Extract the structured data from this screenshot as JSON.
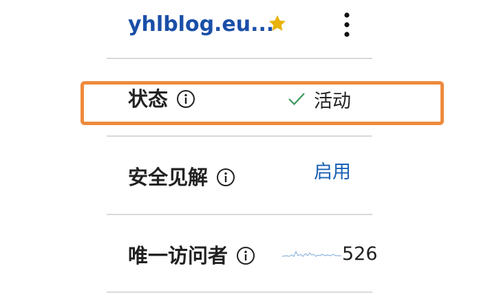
{
  "header": {
    "site_title": "yhlblog.eu...",
    "star_icon": "star-icon",
    "more_icon": "more-vert-icon",
    "star_color": "#e8b20a"
  },
  "rows": {
    "status": {
      "label": "状态",
      "value": "活动",
      "check_color": "#3a9a5c"
    },
    "security_insights": {
      "label": "安全见解",
      "value": "启用"
    },
    "unique_visitors": {
      "label": "唯一访问者",
      "value": "526"
    }
  },
  "highlight_color": "#ee8a3c"
}
